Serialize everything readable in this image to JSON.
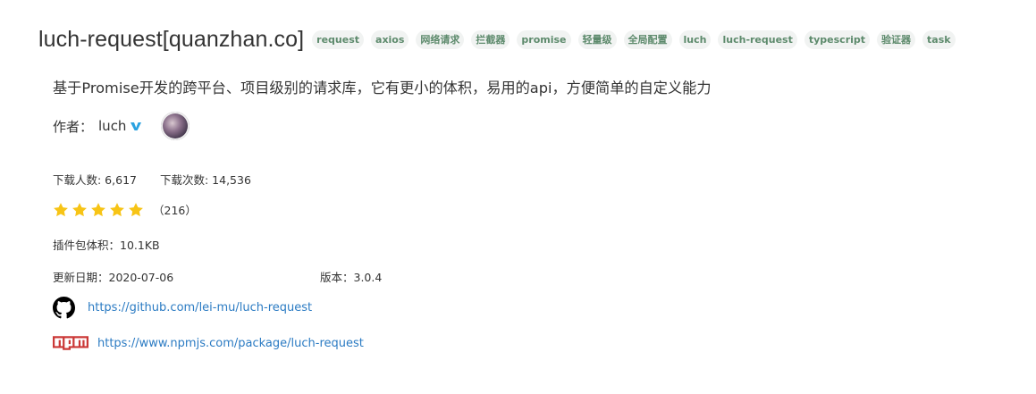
{
  "title": "luch-request[quanzhan.co]",
  "tags": [
    "request",
    "axios",
    "网络请求",
    "拦截器",
    "promise",
    "轻量级",
    "全局配置",
    "luch",
    "luch-request",
    "typescript",
    "验证器",
    "task"
  ],
  "description": "基于Promise开发的跨平台、项目级别的请求库，它有更小的体积，易用的api，方便简单的自定义能力",
  "author": {
    "label": "作者：",
    "name": "luch"
  },
  "stats": {
    "users": "下载人数: 6,617",
    "downloads": "下载次数: 14,536"
  },
  "rating": {
    "stars": 5,
    "max": 5,
    "count": "（216）"
  },
  "size": "插件包体积：10.1KB",
  "updated": "更新日期：2020-07-06",
  "version": "版本：3.0.4",
  "links": {
    "github": "https://github.com/lei-mu/luch-request",
    "npm": "https://www.npmjs.com/package/luch-request"
  },
  "colors": {
    "tag_text": "#5d8a6c",
    "tag_bg": "#f1f3f2",
    "link": "#2b7bc3",
    "star": "#f7c416",
    "npm_red": "#cb3837",
    "verified": "#2aa2e0"
  }
}
